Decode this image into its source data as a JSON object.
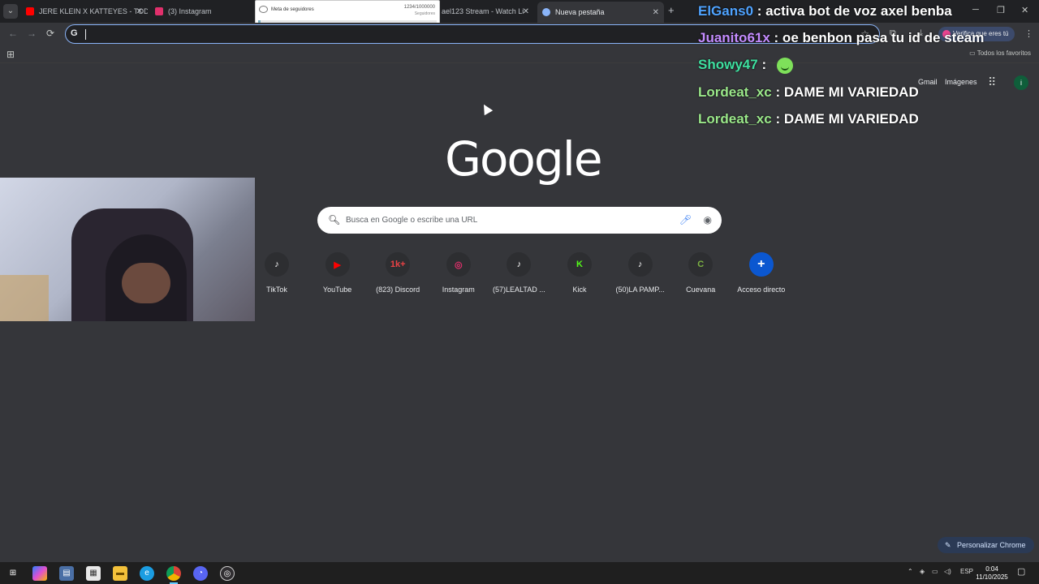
{
  "tabs": [
    {
      "title": "JERE KLEIN X KATTEYES - TODO",
      "favicon_color": "#ff0000",
      "active": false
    },
    {
      "title": "(3) Instagram",
      "favicon_color": "#e1306c",
      "active": false
    },
    {
      "title": "ael123 Stream - Watch Li",
      "favicon_color": "#9146ff",
      "active": false
    },
    {
      "title": "Nueva pestaña",
      "favicon_color": "#8ab4f8",
      "active": true
    }
  ],
  "new_tab_icon": "+",
  "overlay_widget": {
    "title": "Meta de seguidores",
    "count": "1234/1000000",
    "subtitle": "Seguidores",
    "progress": 0.0012
  },
  "window_controls": {
    "minimize": "─",
    "restore": "❐",
    "close": "✕"
  },
  "toolbar": {
    "back": "←",
    "forward": "→",
    "reload": "⟳",
    "omnibox_icon": "G",
    "omnibox_value": "",
    "star": "☆",
    "verify_chip": "Verifica que eres tú",
    "menu": "⋮"
  },
  "bookmarks": {
    "apps_icon": "⊞",
    "all_bookmarks": "Todos los favoritos"
  },
  "ntp": {
    "gmail": "Gmail",
    "images": "Imágenes",
    "apps_icon": "⋮⋮⋮",
    "avatar": "i",
    "logo": "Google",
    "search_placeholder": "Busca en Google o escribe una URL",
    "customize": "Personalizar Chrome",
    "shortcuts": [
      {
        "label": "TikTok",
        "icon": "♪",
        "color": "#ffffff"
      },
      {
        "label": "YouTube",
        "icon": "▶",
        "color": "#ff0000"
      },
      {
        "label": "(823) Discord",
        "icon": "1k+",
        "color": "#ed4245"
      },
      {
        "label": "Instagram",
        "icon": "◎",
        "color": "#e1306c"
      },
      {
        "label": "(57)LEALTAD ...",
        "icon": "♪",
        "color": "#ffffff"
      },
      {
        "label": "Kick",
        "icon": "K",
        "color": "#53fc18"
      },
      {
        "label": "(50)LA PAMP...",
        "icon": "♪",
        "color": "#ffffff"
      },
      {
        "label": "Cuevana",
        "icon": "C",
        "color": "#7cb342"
      },
      {
        "label": "Acceso directo",
        "icon": "+",
        "color": "#d3e3fd"
      }
    ]
  },
  "chat": [
    {
      "user": "ElGans0",
      "message": ": activa bot de voz axel benba",
      "color": "#4fa3ff"
    },
    {
      "user": "Juanito61x",
      "message": ": oe benbon pasa tu id de steam",
      "color": "#c48cff"
    },
    {
      "user": "Showy47",
      "message": ":",
      "color": "#3ee0a0",
      "emoji": true
    },
    {
      "user": "Lordeat_xc",
      "message": ": DAME MI VARIEDAD",
      "color": "#9be88a"
    },
    {
      "user": "Lordeat_xc",
      "message": ": DAME MI VARIEDAD",
      "color": "#9be88a"
    }
  ],
  "taskbar": {
    "apps": [
      "start-icon",
      "copilot-icon",
      "file-app-icon",
      "store-icon",
      "explorer-icon",
      "edge-icon",
      "chrome-icon",
      "discord-icon",
      "obs-icon"
    ],
    "lang": "ESP",
    "time": "0:04",
    "date": "11/10/2025"
  }
}
